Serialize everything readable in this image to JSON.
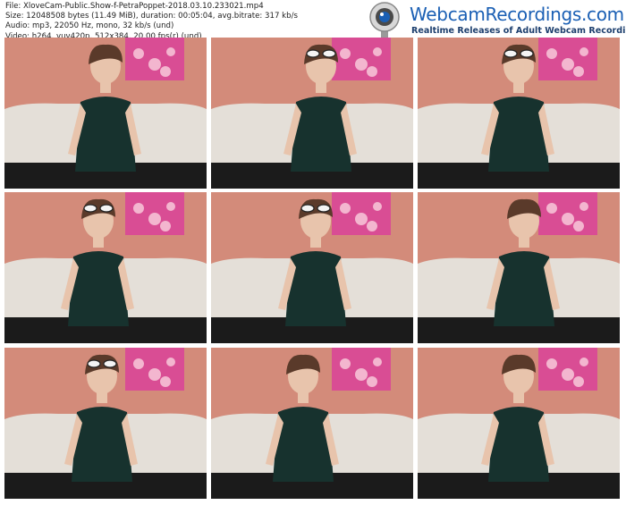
{
  "file_info": {
    "file": "File: XloveCam-Public.Show-f-PetraPoppet-2018.03.10.233021.mp4",
    "size": "Size: 12048508 bytes (11.49 MiB), duration: 00:05:04, avg.bitrate: 317 kb/s",
    "audio": "Audio: mp3, 22050 Hz, mono, 32 kb/s (und)",
    "video": "Video: h264, yuv420p, 512x384, 20.00 fps(r) (und)"
  },
  "logo": {
    "brand": "WebcamRecordings.com",
    "tagline": "Realtime Releases of Adult Webcam Recordings",
    "icon": "webcam-icon"
  },
  "colors": {
    "wall": "#d9907f",
    "wall_shadow": "#c57b6c",
    "sofa": "#e4dfd8",
    "floor": "#1b1b1b",
    "dress": "#17322e",
    "hair": "#5a3a2a",
    "skin": "#e8c4ac",
    "poster": "#d94d94",
    "brand_blue": "#1a5fb4"
  },
  "thumbnails": [
    {
      "label": "frame-1",
      "glasses": false
    },
    {
      "label": "frame-2",
      "glasses": true
    },
    {
      "label": "frame-3",
      "glasses": true
    },
    {
      "label": "frame-4",
      "glasses": true
    },
    {
      "label": "frame-5",
      "glasses": true
    },
    {
      "label": "frame-6",
      "glasses": false
    },
    {
      "label": "frame-7",
      "glasses": true
    },
    {
      "label": "frame-8",
      "glasses": false
    },
    {
      "label": "frame-9",
      "glasses": false
    }
  ]
}
